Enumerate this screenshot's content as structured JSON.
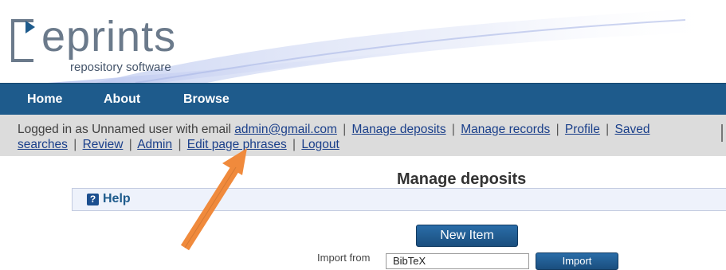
{
  "logo": {
    "word": "eprints",
    "tagline": "repository software"
  },
  "nav": {
    "items": [
      "Home",
      "About",
      "Browse"
    ]
  },
  "login": {
    "prefix": "Logged in as Unnamed user with email",
    "email": "admin@gmail.com",
    "links_line1": [
      "Manage deposits",
      "Manage records",
      "Profile",
      "Saved"
    ],
    "links_line2": [
      "searches",
      "Review",
      "Admin",
      "Edit page phrases",
      "Logout"
    ]
  },
  "page": {
    "title": "Manage deposits"
  },
  "help": {
    "icon_glyph": "?",
    "label": "Help"
  },
  "new_item": {
    "label": "New Item"
  },
  "import": {
    "label": "Import from",
    "selected": "BibTeX",
    "button": "Import"
  },
  "annotation": {
    "arrow_color": "#f08a3c"
  },
  "colors": {
    "navbar": "#1e5b8c",
    "login_bg": "#dcdcdc",
    "link": "#1a3f8a",
    "help_bg": "#eef2fb"
  }
}
